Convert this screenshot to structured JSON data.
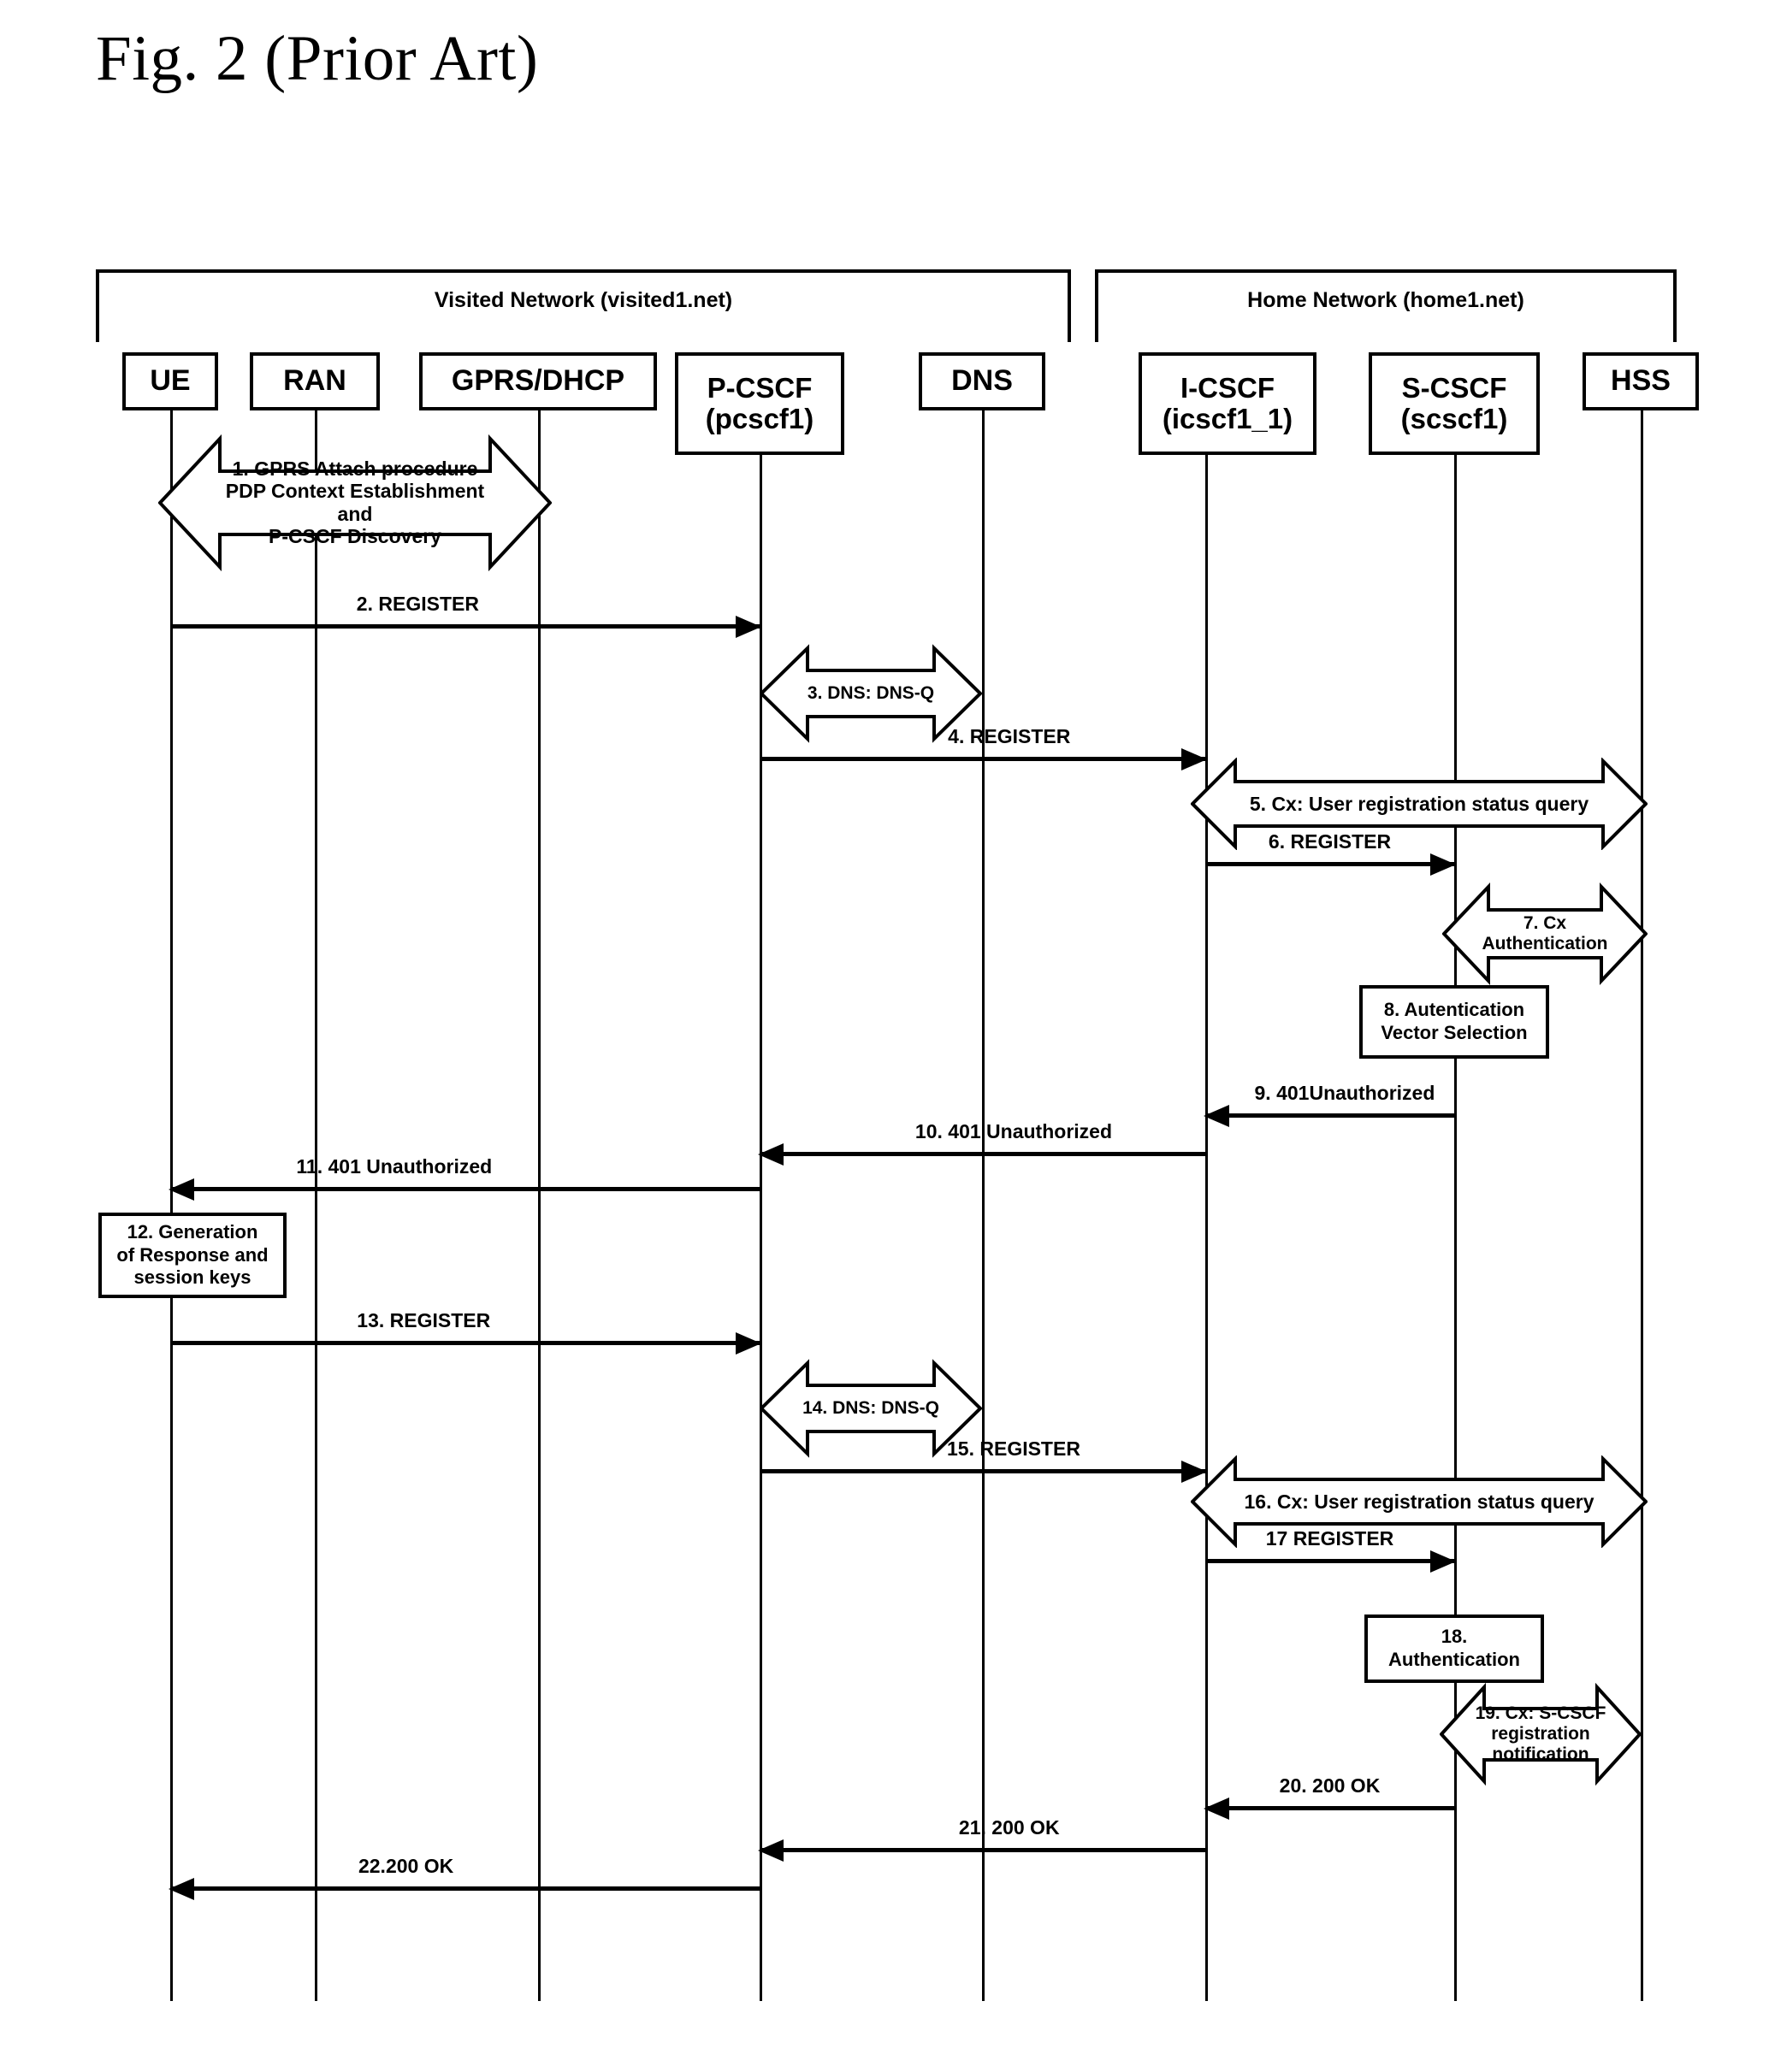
{
  "figure": {
    "title": "Fig. 2 (Prior Art)"
  },
  "networks": [
    {
      "id": "visited",
      "label": "Visited Network (visited1.net)"
    },
    {
      "id": "home",
      "label": "Home Network (home1.net)"
    }
  ],
  "entities": [
    {
      "id": "ue",
      "line1": "UE",
      "line2": ""
    },
    {
      "id": "ran",
      "line1": "RAN",
      "line2": ""
    },
    {
      "id": "gprs",
      "line1": "GPRS/DHCP",
      "line2": ""
    },
    {
      "id": "pcscf",
      "line1": "P-CSCF",
      "line2": "(pcscf1)"
    },
    {
      "id": "dns",
      "line1": "DNS",
      "line2": ""
    },
    {
      "id": "icscf",
      "line1": "I-CSCF",
      "line2": "(icscf1_1)"
    },
    {
      "id": "scscf",
      "line1": "S-CSCF",
      "line2": "(scscf1)"
    },
    {
      "id": "hss",
      "line1": "HSS",
      "line2": ""
    }
  ],
  "messages": {
    "m1": "1. GPRS Attach procedure\nPDP Context Establishment\nand\nP-CSCF Discovery",
    "m2": "2. REGISTER",
    "m3": "3. DNS: DNS-Q",
    "m4": "4. REGISTER",
    "m5": "5. Cx: User registration status query",
    "m6": "6. REGISTER",
    "m7": "7. Cx\nAuthentication",
    "m8": "8. Autentication\nVector Selection",
    "m9": "9. 401Unauthorized",
    "m10": "10. 401 Unauthorized",
    "m11": "11. 401 Unauthorized",
    "m12": "12. Generation\nof Response and\nsession keys",
    "m13": "13. REGISTER",
    "m14": "14. DNS: DNS-Q",
    "m15": "15. REGISTER",
    "m16": "16. Cx: User registration status query",
    "m17": "17 REGISTER",
    "m18": "18.\nAuthentication",
    "m19": "19. Cx: S-CSCF\nregistration\nnotification",
    "m20": "20. 200 OK",
    "m21": "21. 200 OK",
    "m22": "22.200 OK"
  },
  "colors": {
    "ink": "#000000",
    "paper": "#ffffff"
  }
}
